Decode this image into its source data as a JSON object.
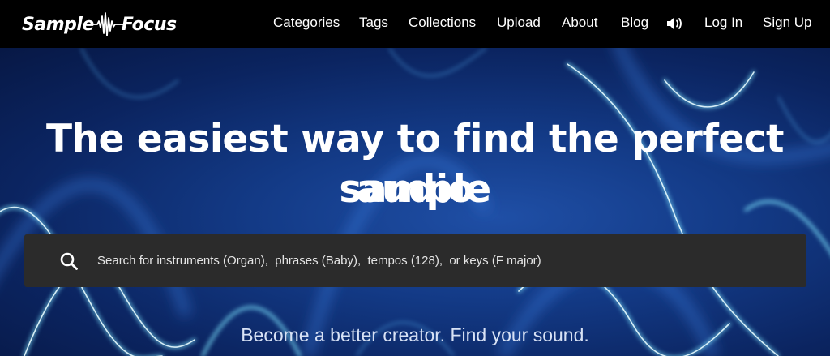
{
  "brand": {
    "name_left": "Sample",
    "name_right": "Focus",
    "logo_icon": "waveform-icon"
  },
  "nav": {
    "links": [
      "Categories",
      "Tags",
      "Collections",
      "Upload",
      "About",
      "Blog"
    ],
    "sound_icon": "speaker-icon",
    "login": "Log In",
    "signup": "Sign Up"
  },
  "hero": {
    "headline_line1": "The easiest way to find the perfect audio",
    "headline_line2": "sample",
    "search": {
      "placeholder": "Search for instruments (Organ),  phrases (Baby),  tempos (128),  or keys (F major)",
      "icon": "search-icon"
    },
    "tagline": "Become a better creator. Find your sound."
  },
  "colors": {
    "navbar_bg": "#000000",
    "hero_bg": "#133a86",
    "search_bg": "#2b2b2b",
    "text": "#ffffff"
  }
}
